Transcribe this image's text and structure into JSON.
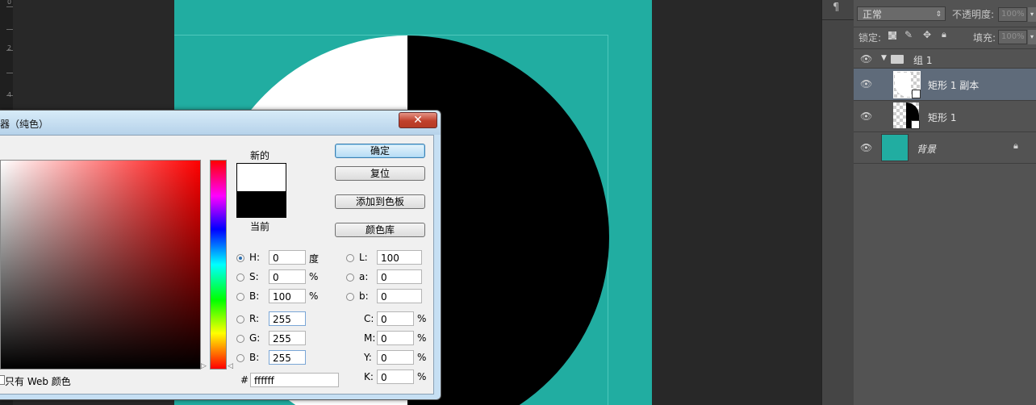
{
  "ruler": {
    "ticks": [
      "0",
      "2",
      "4"
    ]
  },
  "dialog": {
    "title": "器（纯色）",
    "close_label": "✕",
    "new_label": "新的",
    "current_label": "当前",
    "new_color": "#ffffff",
    "current_color": "#000000",
    "buttons": {
      "ok": "确定",
      "reset": "复位",
      "add_swatch": "添加到色板",
      "libraries": "颜色库"
    },
    "hsb": [
      {
        "label": "H:",
        "value": "0",
        "unit": "度",
        "selected": true
      },
      {
        "label": "S:",
        "value": "0",
        "unit": "%",
        "selected": false
      },
      {
        "label": "B:",
        "value": "100",
        "unit": "%",
        "selected": false
      }
    ],
    "rgb": [
      {
        "label": "R:",
        "value": "255"
      },
      {
        "label": "G:",
        "value": "255"
      },
      {
        "label": "B:",
        "value": "255"
      }
    ],
    "lab": [
      {
        "label": "L:",
        "value": "100"
      },
      {
        "label": "a:",
        "value": "0"
      },
      {
        "label": "b:",
        "value": "0"
      }
    ],
    "cmyk": [
      {
        "label": "C:",
        "value": "0",
        "unit": "%"
      },
      {
        "label": "M:",
        "value": "0",
        "unit": "%"
      },
      {
        "label": "Y:",
        "value": "0",
        "unit": "%"
      },
      {
        "label": "K:",
        "value": "0",
        "unit": "%"
      }
    ],
    "hex_label": "#",
    "hex_value": "ffffff",
    "web_only_label": "只有 Web 颜色"
  },
  "layers_panel": {
    "blend_mode": "正常",
    "opacity_label": "不透明度:",
    "opacity_value": "100%",
    "lock_label": "锁定:",
    "fill_label": "填充:",
    "fill_value": "100%",
    "layers": [
      {
        "name": "组 1",
        "type": "group"
      },
      {
        "name": "矩形 1 副本",
        "type": "shape",
        "selected": true
      },
      {
        "name": "矩形 1",
        "type": "shape"
      },
      {
        "name": "背景",
        "type": "background"
      }
    ]
  },
  "colors": {
    "canvas": "#21ada1",
    "accent": "#2b6fb0"
  }
}
